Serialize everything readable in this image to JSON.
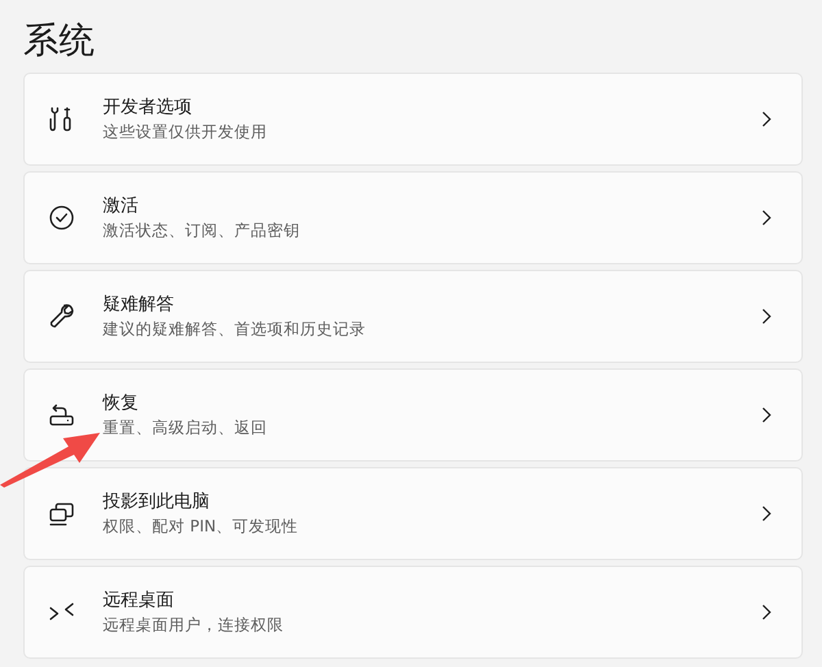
{
  "page_title": "系统",
  "items": [
    {
      "title": "开发者选项",
      "subtitle": "这些设置仅供开发使用"
    },
    {
      "title": "激活",
      "subtitle": "激活状态、订阅、产品密钥"
    },
    {
      "title": "疑难解答",
      "subtitle": "建议的疑难解答、首选项和历史记录"
    },
    {
      "title": "恢复",
      "subtitle": "重置、高级启动、返回"
    },
    {
      "title": "投影到此电脑",
      "subtitle": "权限、配对 PIN、可发现性"
    },
    {
      "title": "远程桌面",
      "subtitle": "远程桌面用户，连接权限"
    }
  ],
  "annotation": {
    "kind": "arrow"
  }
}
